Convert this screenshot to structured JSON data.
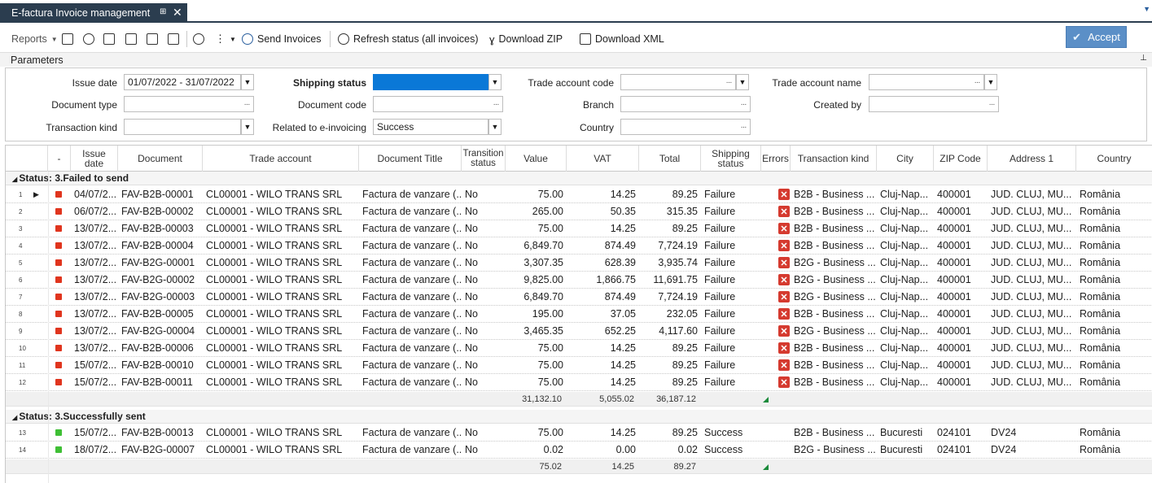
{
  "window": {
    "tab_title": "E-factura Invoice management",
    "pin_icon": "pin-icon",
    "close_icon": "close-icon"
  },
  "toolbar": {
    "reports": "Reports",
    "send": "Send Invoices",
    "refresh": "Refresh status (all invoices)",
    "download_zip": "Download ZIP",
    "download_xml": "Download XML",
    "accept": "Accept"
  },
  "parameters": {
    "title": "Parameters",
    "issue_date_label": "Issue date",
    "issue_date_value": "01/07/2022 - 31/07/2022",
    "shipping_status_label": "Shipping status",
    "shipping_status_value": "",
    "trade_account_code_label": "Trade account code",
    "trade_account_code_value": "",
    "trade_account_name_label": "Trade account name",
    "trade_account_name_value": "",
    "document_type_label": "Document type",
    "document_type_value": "",
    "document_code_label": "Document code",
    "document_code_value": "",
    "branch_label": "Branch",
    "branch_value": "",
    "created_by_label": "Created by",
    "created_by_value": "",
    "transaction_kind_label": "Transaction kind",
    "transaction_kind_value": "",
    "related_label": "Related to e-invoicing",
    "related_value": "Success",
    "country_label": "Country",
    "country_value": ""
  },
  "columns": [
    "-",
    "Issue date",
    "Document",
    "Trade account",
    "Document Title",
    "Transition status",
    "Value",
    "VAT",
    "Total",
    "Shipping status",
    "Errors",
    "Transaction kind",
    "City",
    "ZIP Code",
    "Address 1",
    "Country"
  ],
  "groups": [
    {
      "label": "Status:  3.Failed to send",
      "status_color": "#e0351e",
      "rows": [
        {
          "n": "1",
          "date": "04/07/2...",
          "doc": "FAV-B2B-00001",
          "acct": "CL00001 - WILO TRANS SRL",
          "title": "Factura de vanzare (...",
          "trans": "No",
          "value": "75.00",
          "vat": "14.25",
          "total": "89.25",
          "ship": "Failure",
          "kind": "B2B - Business ...",
          "city": "Cluj-Nap...",
          "zip": "400001",
          "addr": "JUD. CLUJ, MU...",
          "country": "România"
        },
        {
          "n": "2",
          "date": "06/07/2...",
          "doc": "FAV-B2B-00002",
          "acct": "CL00001 - WILO TRANS SRL",
          "title": "Factura de vanzare (...",
          "trans": "No",
          "value": "265.00",
          "vat": "50.35",
          "total": "315.35",
          "ship": "Failure",
          "kind": "B2B - Business ...",
          "city": "Cluj-Nap...",
          "zip": "400001",
          "addr": "JUD. CLUJ, MU...",
          "country": "România"
        },
        {
          "n": "3",
          "date": "13/07/2...",
          "doc": "FAV-B2B-00003",
          "acct": "CL00001 - WILO TRANS SRL",
          "title": "Factura de vanzare (...",
          "trans": "No",
          "value": "75.00",
          "vat": "14.25",
          "total": "89.25",
          "ship": "Failure",
          "kind": "B2B - Business ...",
          "city": "Cluj-Nap...",
          "zip": "400001",
          "addr": "JUD. CLUJ, MU...",
          "country": "România"
        },
        {
          "n": "4",
          "date": "13/07/2...",
          "doc": "FAV-B2B-00004",
          "acct": "CL00001 - WILO TRANS SRL",
          "title": "Factura de vanzare (...",
          "trans": "No",
          "value": "6,849.70",
          "vat": "874.49",
          "total": "7,724.19",
          "ship": "Failure",
          "kind": "B2B - Business ...",
          "city": "Cluj-Nap...",
          "zip": "400001",
          "addr": "JUD. CLUJ, MU...",
          "country": "România"
        },
        {
          "n": "5",
          "date": "13/07/2...",
          "doc": "FAV-B2G-00001",
          "acct": "CL00001 - WILO TRANS SRL",
          "title": "Factura de vanzare (...",
          "trans": "No",
          "value": "3,307.35",
          "vat": "628.39",
          "total": "3,935.74",
          "ship": "Failure",
          "kind": "B2G - Business ...",
          "city": "Cluj-Nap...",
          "zip": "400001",
          "addr": "JUD. CLUJ, MU...",
          "country": "România"
        },
        {
          "n": "6",
          "date": "13/07/2...",
          "doc": "FAV-B2G-00002",
          "acct": "CL00001 - WILO TRANS SRL",
          "title": "Factura de vanzare (...",
          "trans": "No",
          "value": "9,825.00",
          "vat": "1,866.75",
          "total": "11,691.75",
          "ship": "Failure",
          "kind": "B2G - Business ...",
          "city": "Cluj-Nap...",
          "zip": "400001",
          "addr": "JUD. CLUJ, MU...",
          "country": "România"
        },
        {
          "n": "7",
          "date": "13/07/2...",
          "doc": "FAV-B2G-00003",
          "acct": "CL00001 - WILO TRANS SRL",
          "title": "Factura de vanzare (...",
          "trans": "No",
          "value": "6,849.70",
          "vat": "874.49",
          "total": "7,724.19",
          "ship": "Failure",
          "kind": "B2G - Business ...",
          "city": "Cluj-Nap...",
          "zip": "400001",
          "addr": "JUD. CLUJ, MU...",
          "country": "România"
        },
        {
          "n": "8",
          "date": "13/07/2...",
          "doc": "FAV-B2B-00005",
          "acct": "CL00001 - WILO TRANS SRL",
          "title": "Factura de vanzare (...",
          "trans": "No",
          "value": "195.00",
          "vat": "37.05",
          "total": "232.05",
          "ship": "Failure",
          "kind": "B2B - Business ...",
          "city": "Cluj-Nap...",
          "zip": "400001",
          "addr": "JUD. CLUJ, MU...",
          "country": "România"
        },
        {
          "n": "9",
          "date": "13/07/2...",
          "doc": "FAV-B2G-00004",
          "acct": "CL00001 - WILO TRANS SRL",
          "title": "Factura de vanzare (...",
          "trans": "No",
          "value": "3,465.35",
          "vat": "652.25",
          "total": "4,117.60",
          "ship": "Failure",
          "kind": "B2G - Business ...",
          "city": "Cluj-Nap...",
          "zip": "400001",
          "addr": "JUD. CLUJ, MU...",
          "country": "România"
        },
        {
          "n": "10",
          "date": "13/07/2...",
          "doc": "FAV-B2B-00006",
          "acct": "CL00001 - WILO TRANS SRL",
          "title": "Factura de vanzare (...",
          "trans": "No",
          "value": "75.00",
          "vat": "14.25",
          "total": "89.25",
          "ship": "Failure",
          "kind": "B2B - Business ...",
          "city": "Cluj-Nap...",
          "zip": "400001",
          "addr": "JUD. CLUJ, MU...",
          "country": "România"
        },
        {
          "n": "11",
          "date": "15/07/2...",
          "doc": "FAV-B2B-00010",
          "acct": "CL00001 - WILO TRANS SRL",
          "title": "Factura de vanzare (...",
          "trans": "No",
          "value": "75.00",
          "vat": "14.25",
          "total": "89.25",
          "ship": "Failure",
          "kind": "B2B - Business ...",
          "city": "Cluj-Nap...",
          "zip": "400001",
          "addr": "JUD. CLUJ, MU...",
          "country": "România"
        },
        {
          "n": "12",
          "date": "15/07/2...",
          "doc": "FAV-B2B-00011",
          "acct": "CL00001 - WILO TRANS SRL",
          "title": "Factura de vanzare (...",
          "trans": "No",
          "value": "75.00",
          "vat": "14.25",
          "total": "89.25",
          "ship": "Failure",
          "kind": "B2B - Business ...",
          "city": "Cluj-Nap...",
          "zip": "400001",
          "addr": "JUD. CLUJ, MU...",
          "country": "România"
        }
      ],
      "footer": {
        "value": "31,132.10",
        "vat": "5,055.02",
        "total": "36,187.12"
      }
    },
    {
      "label": "Status:  3.Successfully sent",
      "status_color": "#3fbf35",
      "rows": [
        {
          "n": "13",
          "date": "15/07/2...",
          "doc": "FAV-B2B-00013",
          "acct": "CL00001 - WILO TRANS SRL",
          "title": "Factura de vanzare (...",
          "trans": "No",
          "value": "75.00",
          "vat": "14.25",
          "total": "89.25",
          "ship": "Success",
          "kind": "B2B - Business ...",
          "city": "Bucuresti",
          "zip": "024101",
          "addr": "DV24",
          "country": "România"
        },
        {
          "n": "14",
          "date": "18/07/2...",
          "doc": "FAV-B2G-00007",
          "acct": "CL00001 - WILO TRANS SRL",
          "title": "Factura de vanzare (...",
          "trans": "No",
          "value": "0.02",
          "vat": "0.00",
          "total": "0.02",
          "ship": "Success",
          "kind": "B2G - Business ...",
          "city": "Bucuresti",
          "zip": "024101",
          "addr": "DV24",
          "country": "România"
        }
      ],
      "footer": {
        "value": "75.02",
        "vat": "14.25",
        "total": "89.27"
      }
    }
  ]
}
